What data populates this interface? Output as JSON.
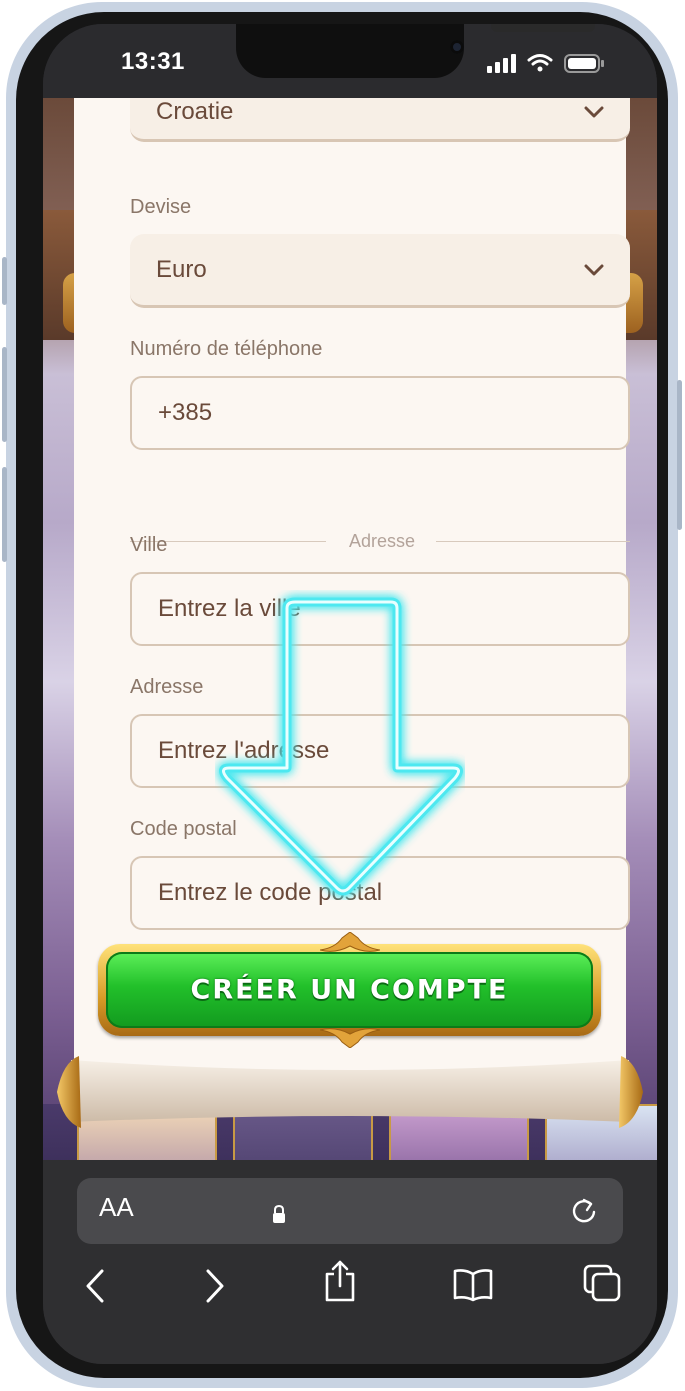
{
  "status_bar": {
    "time": "13:31"
  },
  "form": {
    "country": {
      "value": "Croatie"
    },
    "currency": {
      "label": "Devise",
      "value": "Euro"
    },
    "phone": {
      "label": "Numéro de téléphone",
      "value": "+385"
    },
    "address_section_label": "Adresse",
    "city": {
      "label": "Ville",
      "placeholder": "Entrez la ville"
    },
    "address": {
      "label": "Adresse",
      "placeholder": "Entrez l'adresse"
    },
    "postal_code": {
      "label": "Code postal",
      "placeholder": "Entrez le code postal"
    },
    "submit_label": "CRÉER UN COMPTE"
  },
  "browser": {
    "text_size_label": "AA"
  },
  "colors": {
    "button_green": "#22c02a",
    "button_gold": "#d69a26",
    "label_text": "#8a7668",
    "value_text": "#6a4a3a",
    "arrow_glow": "#4de8f0"
  },
  "icons": [
    "chevron-down-icon",
    "lock-icon",
    "reload-icon",
    "back-icon",
    "forward-icon",
    "share-icon",
    "bookmarks-icon",
    "tabs-icon",
    "signal-icon",
    "wifi-icon",
    "battery-icon",
    "down-arrow-overlay-icon"
  ]
}
